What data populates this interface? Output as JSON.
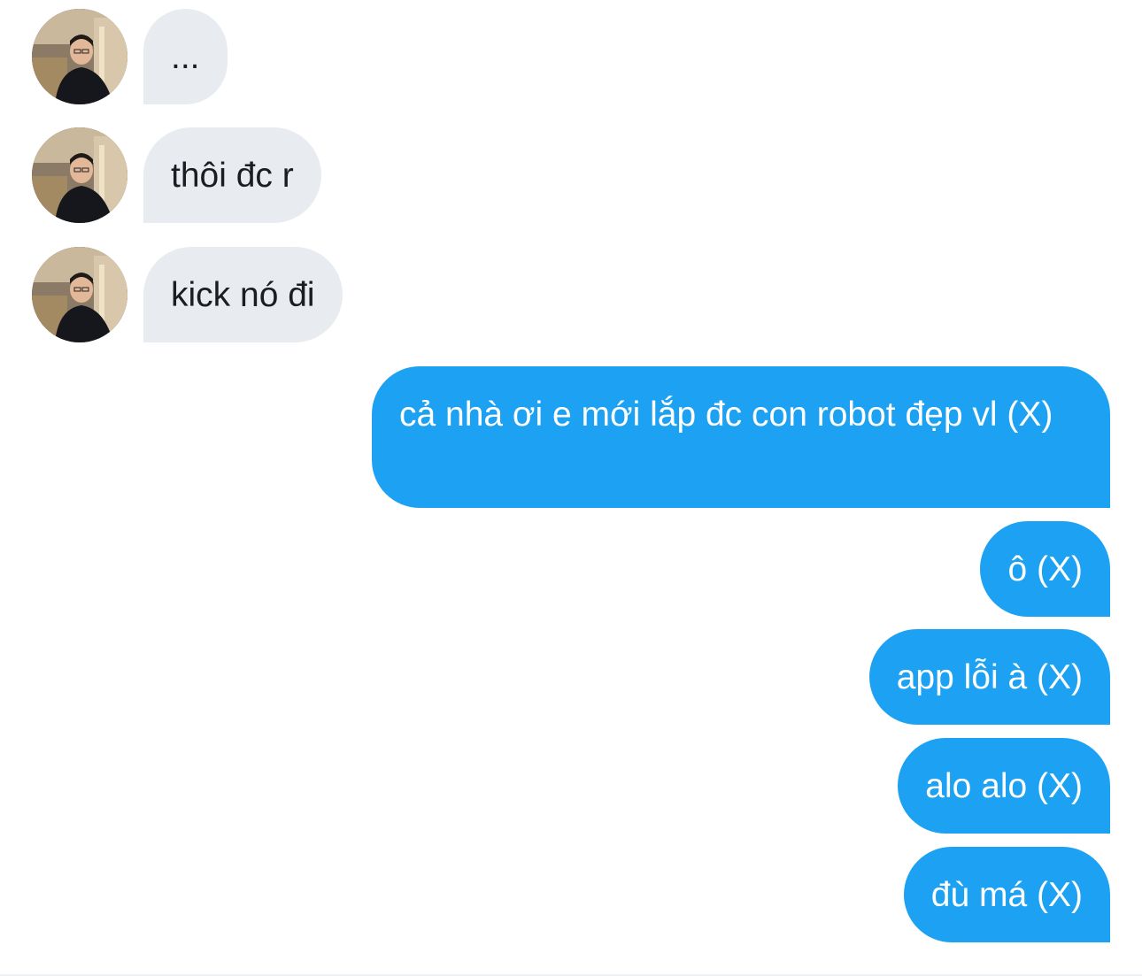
{
  "conversation": {
    "incoming": [
      {
        "text": "..."
      },
      {
        "text": "thôi đc r"
      },
      {
        "text": "kick nó đi"
      }
    ],
    "outgoing": [
      {
        "text": "cả nhà ơi e mới lắp đc con robot đẹp vl (X)"
      },
      {
        "text": "ô (X)"
      },
      {
        "text": "app lỗi à (X)"
      },
      {
        "text": "alo alo (X)"
      },
      {
        "text": "đù má (X)"
      }
    ]
  },
  "colors": {
    "incoming_bubble": "#e8ecf0",
    "outgoing_bubble": "#1da1f2",
    "incoming_text": "#1a1d22",
    "outgoing_text": "#ffffff"
  }
}
